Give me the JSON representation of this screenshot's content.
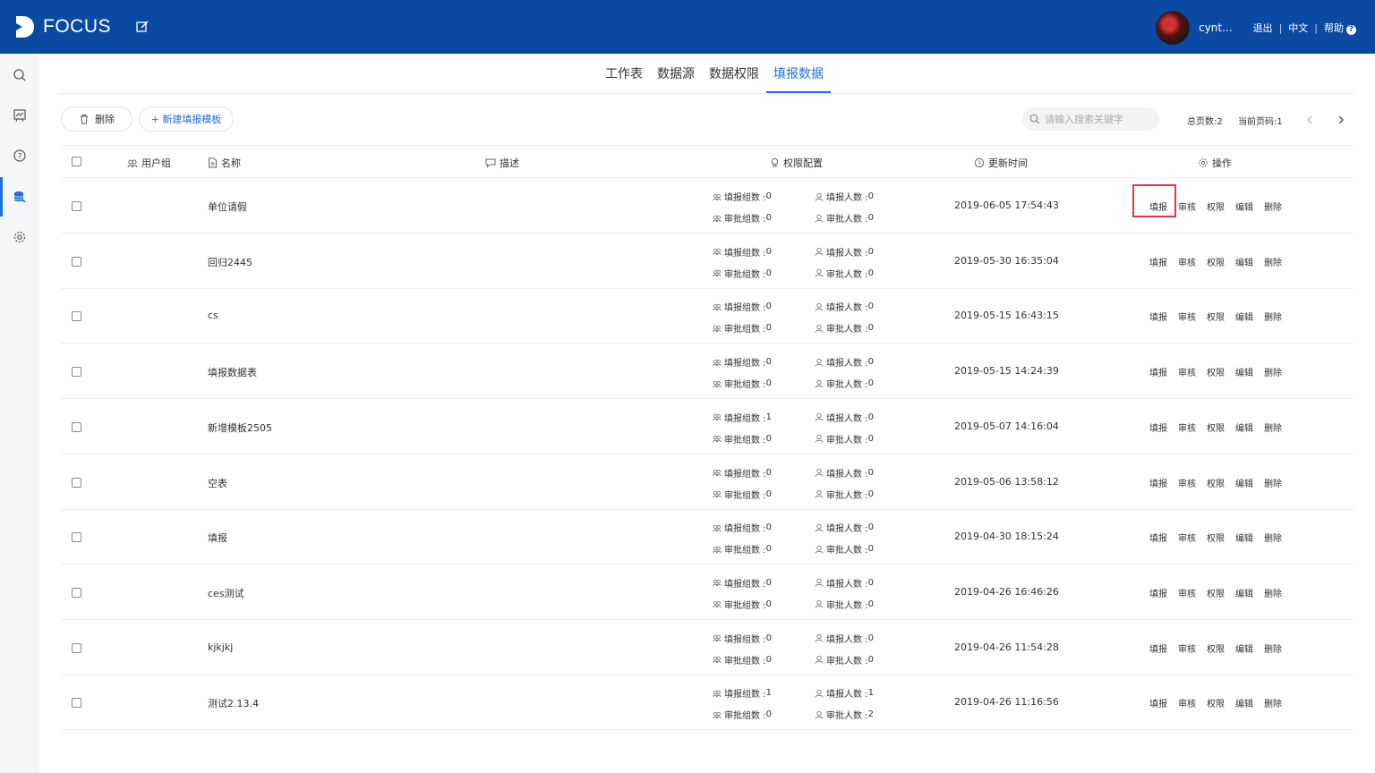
{
  "header": {
    "logo_text": "FOCUS",
    "username": "cynt...",
    "logout": "退出",
    "language": "中文",
    "help": "帮助",
    "help_icon": "?"
  },
  "sidebar": {
    "items": [
      {
        "icon": "search-icon"
      },
      {
        "icon": "dashboard-icon"
      },
      {
        "icon": "question-icon"
      },
      {
        "icon": "database-icon",
        "active": true
      },
      {
        "icon": "gear-icon"
      }
    ]
  },
  "tabs": [
    "工作表",
    "数据源",
    "数据权限",
    "填报数据"
  ],
  "active_tab": "填报数据",
  "toolbar": {
    "delete_label": "删除",
    "new_template_label": "+ 新建填报模板",
    "search_placeholder": "请输入搜索关键字",
    "total_pages": "总页数:2",
    "current_page": "当前页码:1"
  },
  "table": {
    "columns": {
      "user_group": "用户组",
      "name": "名称",
      "description": "描述",
      "permission": "权限配置",
      "update_time": "更新时间",
      "operations": "操作"
    },
    "perm_labels": {
      "fill_groups": "填报组数 : ",
      "approve_groups": "审批组数 : ",
      "fill_people": "填报人数 : ",
      "approve_people": "审批人数 : "
    },
    "op_labels": [
      "填报",
      "审核",
      "权限",
      "编辑",
      "删除"
    ],
    "rows": [
      {
        "name": "单位请假",
        "fill_groups": "0",
        "approve_groups": "0",
        "fill_people": "0",
        "approve_people": "0",
        "time": "2019-06-05 17:54:43"
      },
      {
        "name": "回归2445",
        "fill_groups": "0",
        "approve_groups": "0",
        "fill_people": "0",
        "approve_people": "0",
        "time": "2019-05-30 16:35:04"
      },
      {
        "name": "cs",
        "fill_groups": "0",
        "approve_groups": "0",
        "fill_people": "0",
        "approve_people": "0",
        "time": "2019-05-15 16:43:15"
      },
      {
        "name": "填报数据表",
        "fill_groups": "0",
        "approve_groups": "0",
        "fill_people": "0",
        "approve_people": "0",
        "time": "2019-05-15 14:24:39"
      },
      {
        "name": "新增模板2505",
        "fill_groups": "1",
        "approve_groups": "0",
        "fill_people": "0",
        "approve_people": "0",
        "time": "2019-05-07 14:16:04"
      },
      {
        "name": "空表",
        "fill_groups": "0",
        "approve_groups": "0",
        "fill_people": "0",
        "approve_people": "0",
        "time": "2019-05-06 13:58:12"
      },
      {
        "name": "填报",
        "fill_groups": "0",
        "approve_groups": "0",
        "fill_people": "0",
        "approve_people": "0",
        "time": "2019-04-30 18:15:24"
      },
      {
        "name": "ces测试",
        "fill_groups": "0",
        "approve_groups": "0",
        "fill_people": "0",
        "approve_people": "0",
        "time": "2019-04-26 16:46:26"
      },
      {
        "name": "kjkjkj",
        "fill_groups": "0",
        "approve_groups": "0",
        "fill_people": "0",
        "approve_people": "0",
        "time": "2019-04-26 11:54:28"
      },
      {
        "name": "测试2.13.4",
        "fill_groups": "1",
        "approve_groups": "0",
        "fill_people": "1",
        "approve_people": "2",
        "time": "2019-04-26 11:16:56"
      }
    ]
  },
  "colors": {
    "brand": "#0b4aa2",
    "accent": "#1f6fe0",
    "highlight": "#e53935"
  }
}
